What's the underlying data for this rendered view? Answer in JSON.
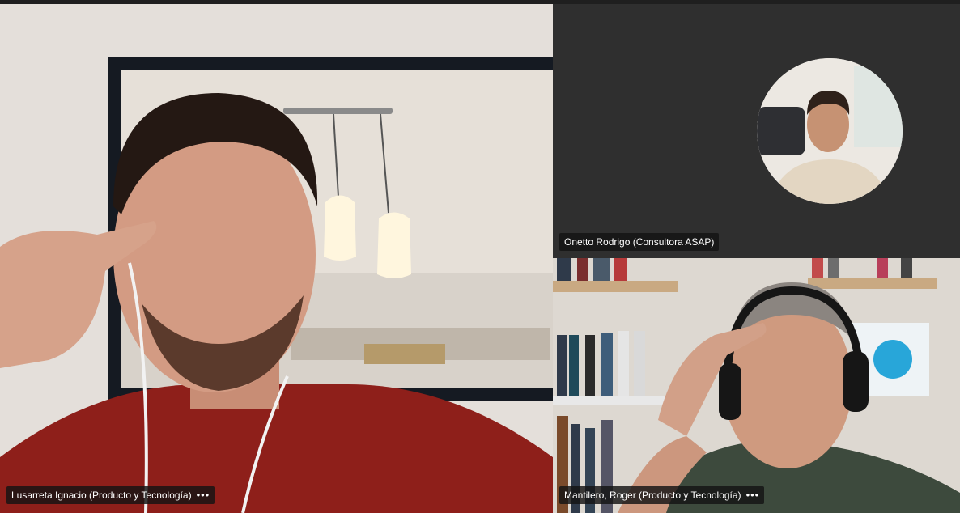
{
  "participants": [
    {
      "name": "Lusarreta Ignacio (Producto y Tecnología)",
      "more": "•••"
    },
    {
      "name": "Onetto Rodrigo (Consultora ASAP)"
    },
    {
      "name": "Mantilero, Roger (Producto y Tecnología)",
      "more": "•••"
    }
  ]
}
